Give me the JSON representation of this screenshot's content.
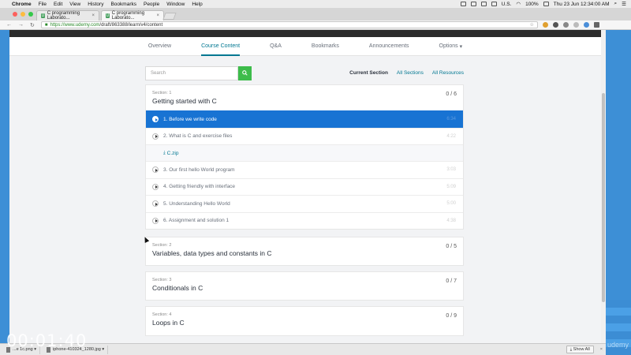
{
  "menubar": {
    "apple": "",
    "items": [
      "Chrome",
      "File",
      "Edit",
      "View",
      "History",
      "Bookmarks",
      "People",
      "Window",
      "Help"
    ],
    "locale": "U.S.",
    "battery": "100%",
    "clock": "Thu 23 Jun  12:34:00 AM"
  },
  "browser": {
    "tabs": [
      {
        "title": "C programming Laborato...",
        "favicon": "U"
      },
      {
        "title": "C programming Laborato...",
        "favicon": "U"
      }
    ],
    "url_host": "https://www.udemy.com",
    "url_path": "/draft/863388/learn/v4/content"
  },
  "course_nav": {
    "tabs": [
      "Overview",
      "Course Content",
      "Q&A",
      "Bookmarks",
      "Announcements",
      "Options"
    ]
  },
  "search": {
    "placeholder": "Search"
  },
  "filters": [
    "Current Section",
    "All Sections",
    "All Resources"
  ],
  "sections": [
    {
      "number": "Section: 1",
      "title": "Getting started with C",
      "count": "0 / 6",
      "lectures": [
        {
          "title": "1. Before we write code",
          "duration": "6:34"
        },
        {
          "title": "2. What is C and exercise files",
          "duration": "4:22"
        },
        {
          "title": "3. Our first hello World program",
          "duration": "3:03"
        },
        {
          "title": "4. Getting friendly with interface",
          "duration": "5:09"
        },
        {
          "title": "5. Understanding Hello World",
          "duration": "5:00"
        },
        {
          "title": "6. Assignment and solution 1",
          "duration": "4:38"
        }
      ],
      "resource": "C.zip"
    },
    {
      "number": "Section: 2",
      "title": "Variables, data types and constants in C",
      "count": "0 / 5"
    },
    {
      "number": "Section: 3",
      "title": "Conditionals in C",
      "count": "0 / 7"
    },
    {
      "number": "Section: 4",
      "title": "Loops in C",
      "count": "0 / 9"
    }
  ],
  "downloads": {
    "items": [
      "...e 1c.png",
      "iphone-410324_1280.jpg"
    ],
    "show_all": "Show All"
  },
  "overlay": {
    "timer": "00:01:40",
    "watermark": "udemy"
  }
}
